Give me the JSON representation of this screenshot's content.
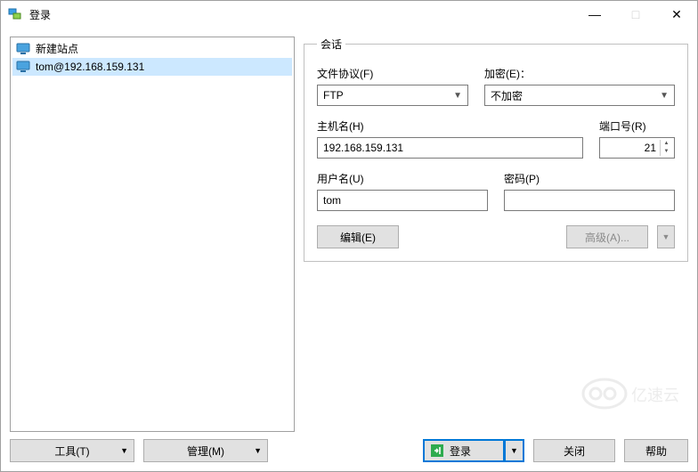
{
  "window": {
    "title": "登录"
  },
  "tree": {
    "items": [
      {
        "label": "新建站点",
        "selected": false
      },
      {
        "label": "tom@192.168.159.131",
        "selected": true
      }
    ]
  },
  "session": {
    "legend": "会话",
    "protocol": {
      "label": "文件协议(F)",
      "value": "FTP"
    },
    "encryption": {
      "label": "加密(E)：",
      "value": "不加密"
    },
    "host": {
      "label": "主机名(H)",
      "value": "192.168.159.131"
    },
    "port": {
      "label": "端口号(R)",
      "value": "21"
    },
    "username": {
      "label": "用户名(U)",
      "value": "tom"
    },
    "password": {
      "label": "密码(P)",
      "value": ""
    },
    "edit_btn": "编辑(E)",
    "advanced_btn": "高级(A)..."
  },
  "footer": {
    "tools_btn": "工具(T)",
    "manage_btn": "管理(M)",
    "login_btn": "登录",
    "close_btn": "关闭",
    "help_btn": "帮助"
  },
  "watermark": "亿速云"
}
